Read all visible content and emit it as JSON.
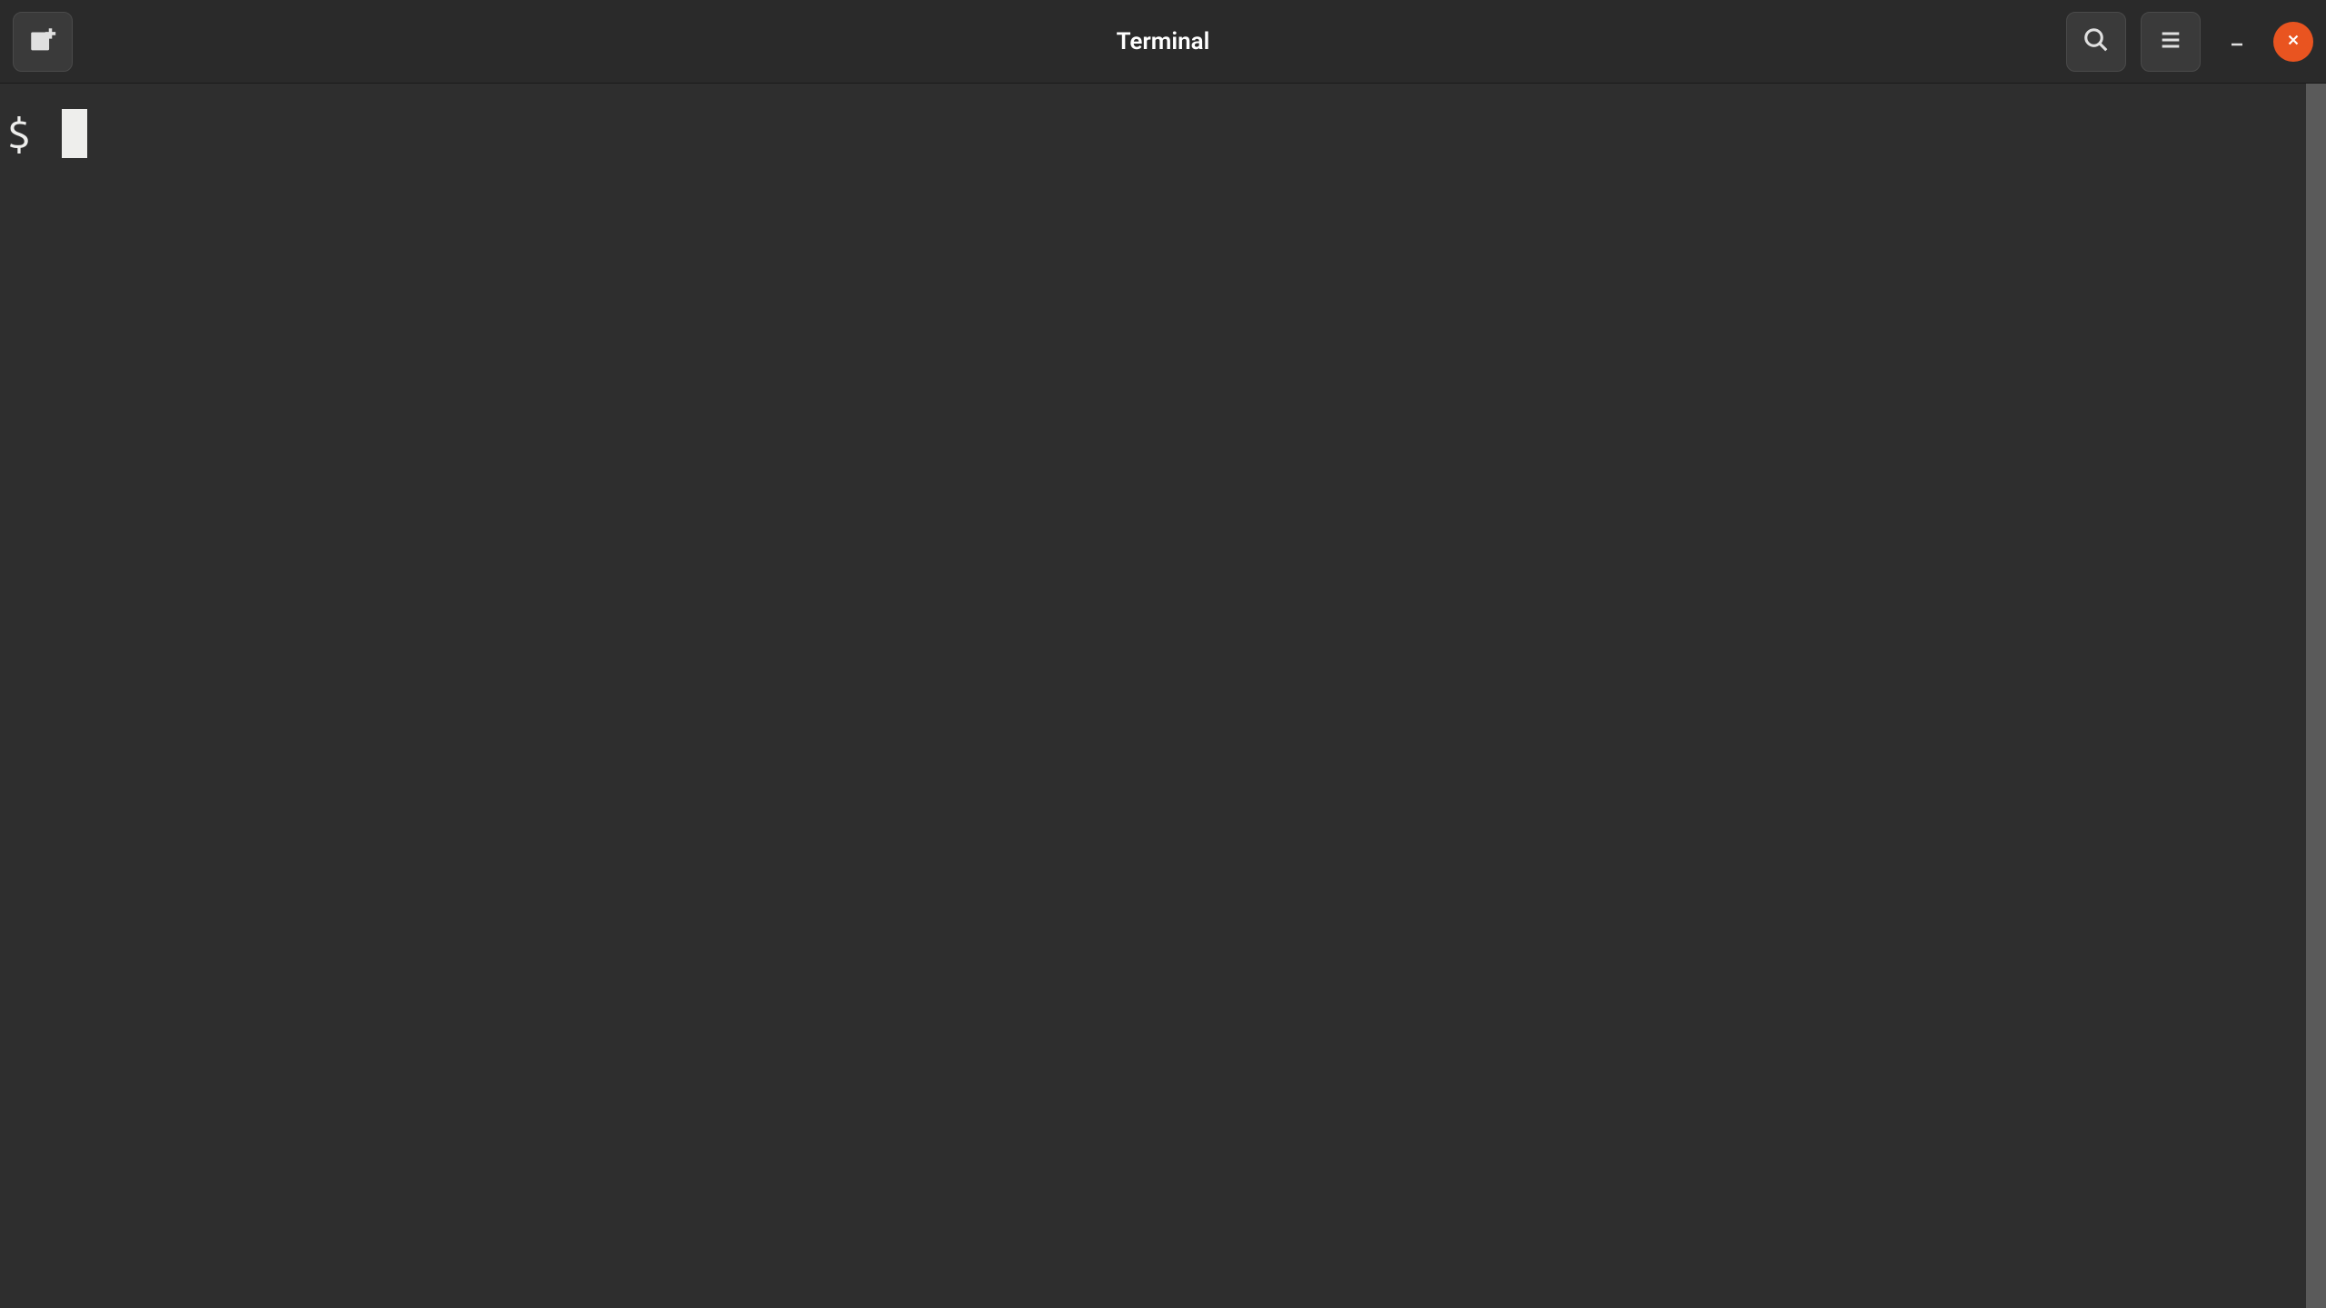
{
  "window": {
    "title": "Terminal"
  },
  "terminal": {
    "prompt": "$ ",
    "input": ""
  },
  "colors": {
    "accent": "#e95420",
    "background": "#2e2e2e",
    "titlebar": "#2a2a2a",
    "text": "#eeeeec"
  }
}
